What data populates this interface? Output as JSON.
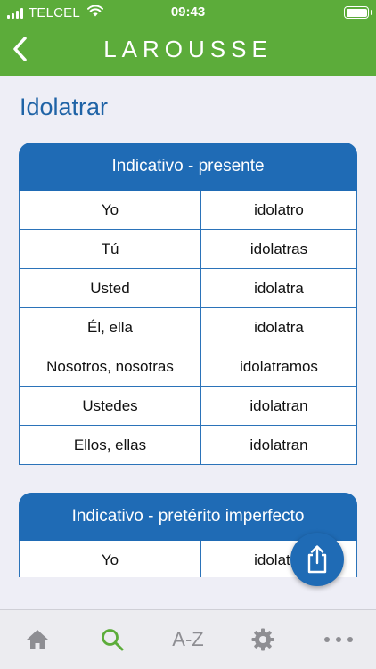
{
  "status_bar": {
    "carrier": "TELCEL",
    "time": "09:43"
  },
  "header": {
    "brand": "LAROUSSE",
    "back_icon": "chevron-left-icon"
  },
  "page": {
    "title": "Idolatrar"
  },
  "tables": [
    {
      "heading": "Indicativo - presente",
      "rows": [
        {
          "pronoun": "Yo",
          "form": "idolatro"
        },
        {
          "pronoun": "Tú",
          "form": "idolatras"
        },
        {
          "pronoun": "Usted",
          "form": "idolatra"
        },
        {
          "pronoun": "Él, ella",
          "form": "idolatra"
        },
        {
          "pronoun": "Nosotros, nosotras",
          "form": "idolatramos"
        },
        {
          "pronoun": "Ustedes",
          "form": "idolatran"
        },
        {
          "pronoun": "Ellos, ellas",
          "form": "idolatran"
        }
      ]
    },
    {
      "heading": "Indicativo - pretérito imperfecto",
      "rows": [
        {
          "pronoun": "Yo",
          "form": "idolatra"
        }
      ]
    }
  ],
  "share_icon": "share-icon",
  "tabbar": {
    "home_icon": "home-icon",
    "search_icon": "search-icon",
    "az_label": "A-Z",
    "settings_icon": "gear-icon",
    "more_icon": "more-dots-icon"
  },
  "colors": {
    "header_green": "#5cac3a",
    "accent_blue": "#1f6bb5",
    "title_blue": "#1f63a6",
    "active_tab_green": "#5cac3a"
  }
}
